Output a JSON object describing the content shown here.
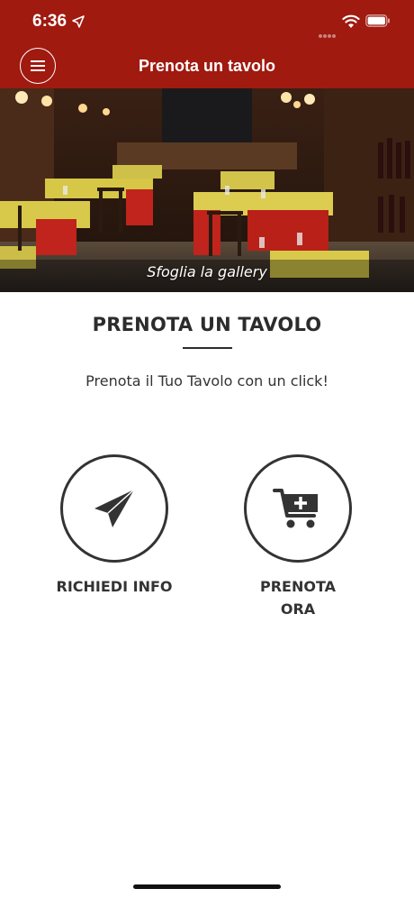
{
  "status_bar": {
    "time": "6:36"
  },
  "header": {
    "title": "Prenota un tavolo"
  },
  "hero": {
    "caption": "Sfoglia la gallery"
  },
  "section": {
    "title": "PRENOTA UN TAVOLO",
    "subtitle": "Prenota il Tuo Tavolo con un click!"
  },
  "actions": [
    {
      "label": "RICHIEDI INFO",
      "icon": "paper-plane-icon"
    },
    {
      "label": "PRENOTA ORA",
      "icon": "cart-add-icon"
    }
  ],
  "colors": {
    "header_bg": "#a01a10",
    "text_dark": "#2c2c2c"
  }
}
